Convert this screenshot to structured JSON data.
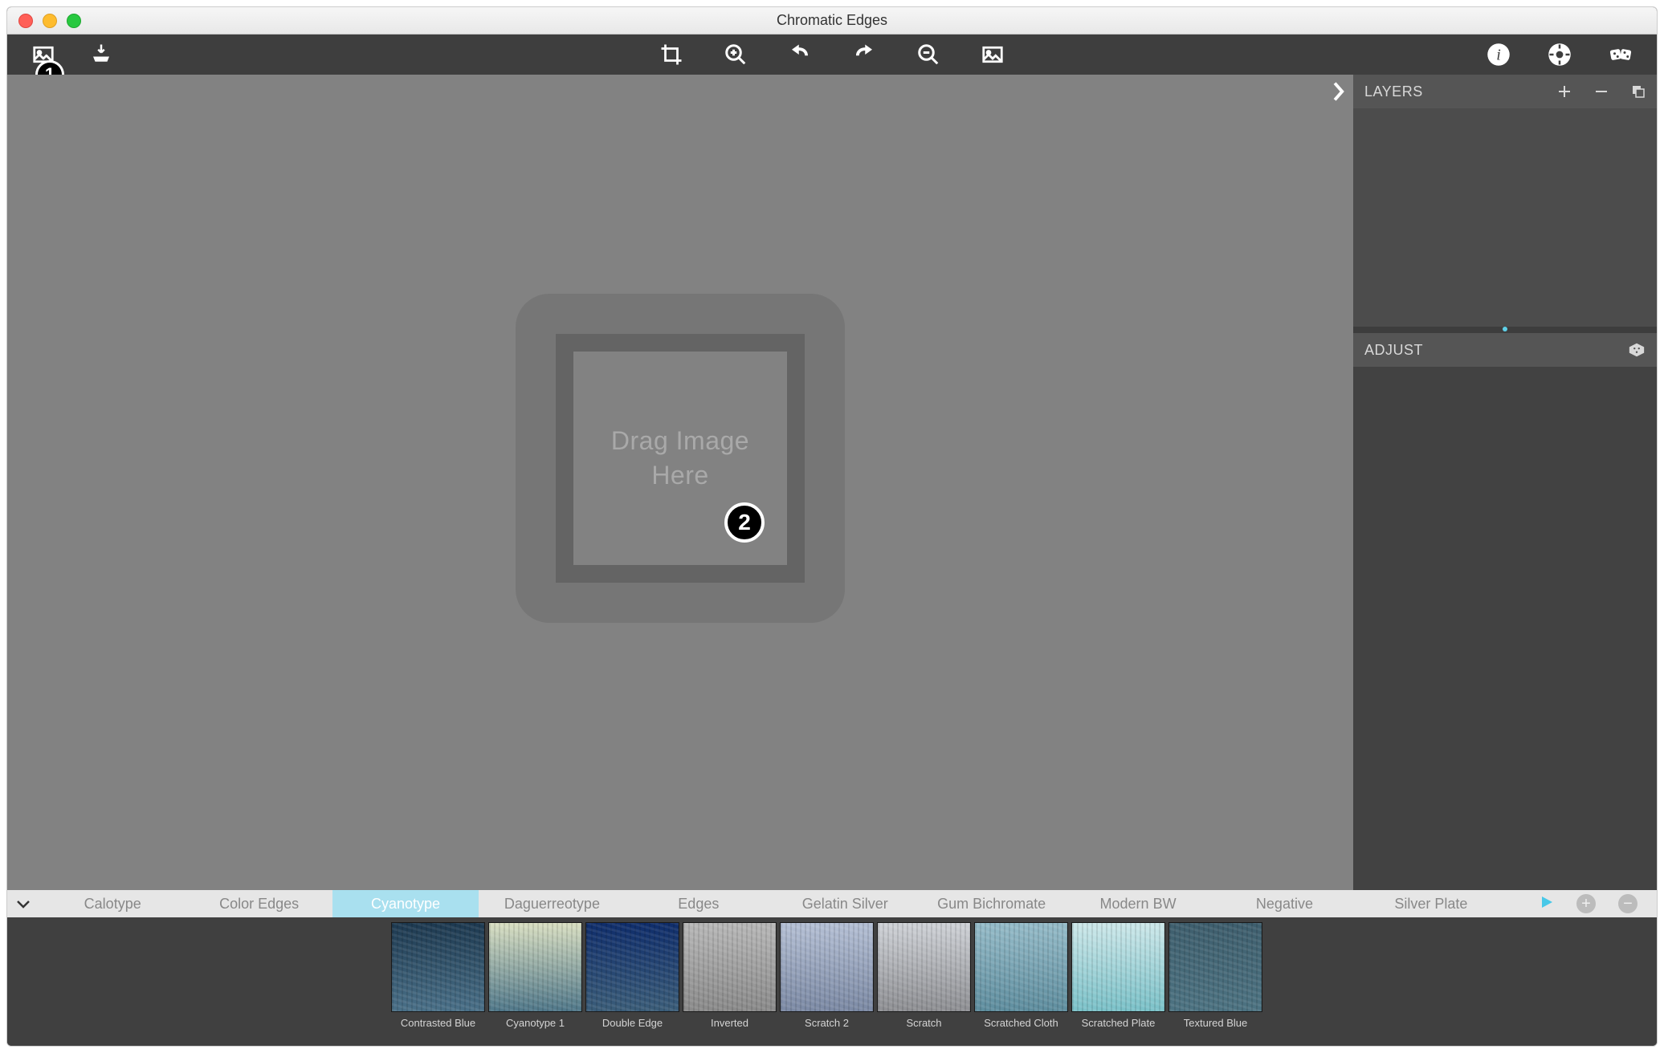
{
  "window": {
    "title": "Chromatic Edges"
  },
  "badges": {
    "one": "1",
    "two": "2"
  },
  "dropzone": {
    "line1": "Drag Image",
    "line2": "Here"
  },
  "sidebar": {
    "layers_label": "LAYERS",
    "adjust_label": "ADJUST"
  },
  "categories": {
    "items": [
      {
        "label": "Calotype",
        "selected": false
      },
      {
        "label": "Color Edges",
        "selected": false
      },
      {
        "label": "Cyanotype",
        "selected": true
      },
      {
        "label": "Daguerreotype",
        "selected": false
      },
      {
        "label": "Edges",
        "selected": false
      },
      {
        "label": "Gelatin Silver",
        "selected": false
      },
      {
        "label": "Gum Bichromate",
        "selected": false
      },
      {
        "label": "Modern BW",
        "selected": false
      },
      {
        "label": "Negative",
        "selected": false
      },
      {
        "label": "Silver Plate",
        "selected": false
      }
    ]
  },
  "presets": [
    {
      "label": "Contrasted Blue",
      "thumb_class": "thumb-cyan1"
    },
    {
      "label": "Cyanotype 1",
      "thumb_class": "thumb-cyan2"
    },
    {
      "label": "Double Edge",
      "thumb_class": "thumb-double"
    },
    {
      "label": "Inverted",
      "thumb_class": "thumb-invert"
    },
    {
      "label": "Scratch 2",
      "thumb_class": "thumb-scr2"
    },
    {
      "label": "Scratch",
      "thumb_class": "thumb-scr"
    },
    {
      "label": "Scratched Cloth",
      "thumb_class": "thumb-cloth"
    },
    {
      "label": "Scratched Plate",
      "thumb_class": "thumb-plate"
    },
    {
      "label": "Textured Blue",
      "thumb_class": "thumb-texblue"
    }
  ]
}
